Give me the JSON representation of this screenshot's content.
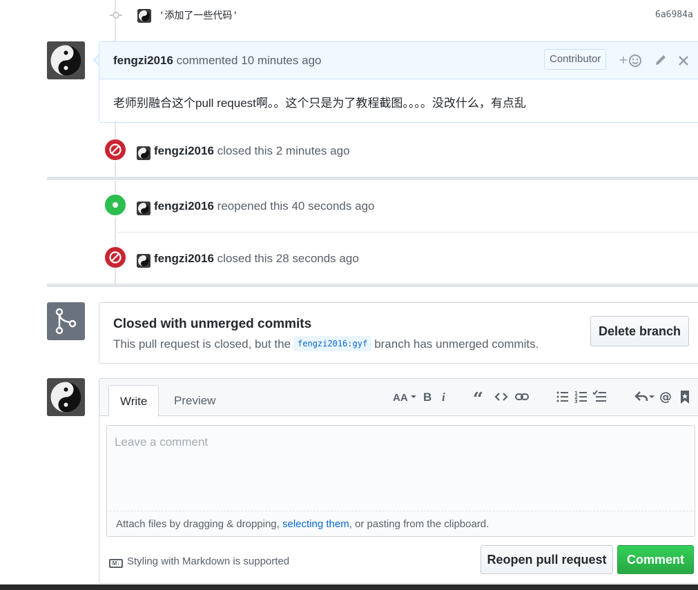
{
  "commit": {
    "message": "'添加了一些代码'",
    "sha": "6a6984a"
  },
  "comment": {
    "author": "fengzi2016",
    "action": "commented",
    "time": "10 minutes ago",
    "badge": "Contributor",
    "body": "老师别融合这个pull request啊。。这个只是为了教程截图。。。。没改什么，有点乱"
  },
  "events": [
    {
      "author": "fengzi2016",
      "action": "closed this",
      "time": "2 minutes ago",
      "status": "closed"
    },
    {
      "author": "fengzi2016",
      "action": "reopened this",
      "time": "40 seconds ago",
      "status": "reopened"
    },
    {
      "author": "fengzi2016",
      "action": "closed this",
      "time": "28 seconds ago",
      "status": "closed"
    }
  ],
  "merge_status": {
    "title": "Closed with unmerged commits",
    "desc_before": "This pull request is closed, but the",
    "branch": "fengzi2016:gyf",
    "desc_after": "branch has unmerged commits.",
    "delete_button": "Delete branch"
  },
  "editor": {
    "tabs": [
      "Write",
      "Preview"
    ],
    "active_tab": "Write",
    "placeholder": "Leave a comment",
    "attach_before": "Attach files by dragging & dropping,",
    "attach_link": "selecting them",
    "attach_after": ", or pasting from the clipboard.",
    "markdown_note": "Styling with Markdown is supported",
    "reopen_button": "Reopen pull request",
    "comment_button": "Comment",
    "toolbar_icons": [
      "text-size-icon",
      "bold-icon",
      "italic-icon",
      "quote-icon",
      "code-icon",
      "link-icon",
      "bullet-list-icon",
      "numbered-list-icon",
      "task-list-icon",
      "reply-icon",
      "mention-icon",
      "saved-reply-icon"
    ]
  },
  "colors": {
    "closed": "#cb2431",
    "open": "#2cbe4e",
    "link": "#0366d6",
    "comment_header": "#f1f8ff"
  }
}
